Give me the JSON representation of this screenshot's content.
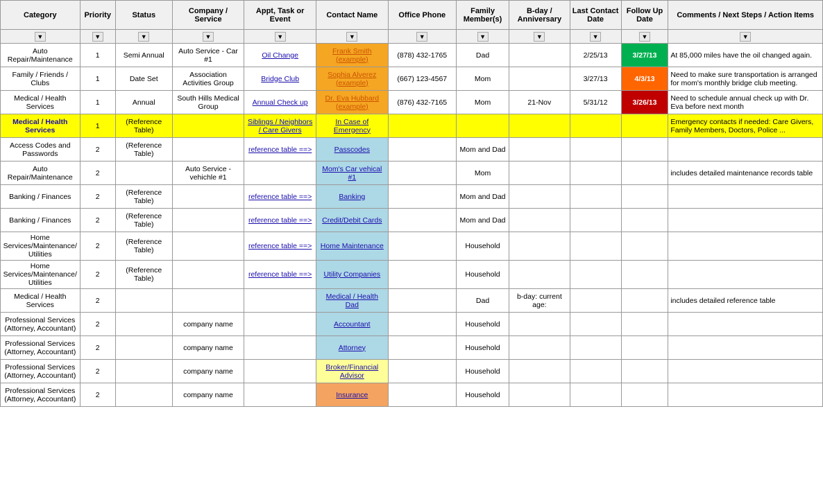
{
  "columns": [
    {
      "label": "Category",
      "class": "col-category"
    },
    {
      "label": "Priority",
      "class": "col-priority"
    },
    {
      "label": "Status",
      "class": "col-status"
    },
    {
      "label": "Company / Service",
      "class": "col-company"
    },
    {
      "label": "Appt, Task or Event",
      "class": "col-appt"
    },
    {
      "label": "Contact Name",
      "class": "col-contact"
    },
    {
      "label": "Office Phone",
      "class": "col-phone"
    },
    {
      "label": "Family Member(s)",
      "class": "col-family"
    },
    {
      "label": "B-day / Anniversary",
      "class": "col-bday"
    },
    {
      "label": "Last Contact Date",
      "class": "col-lastcontact"
    },
    {
      "label": "Follow Up Date",
      "class": "col-followup"
    },
    {
      "label": "Comments / Next Steps / Action Items",
      "class": "col-comments"
    }
  ],
  "rows": [
    {
      "category": "Auto\nRepair/Maintenance",
      "priority": "1",
      "status": "Semi Annual",
      "company": "Auto Service - Car #1",
      "appt": "Oil Change",
      "appt_link": true,
      "contact": "Frank Smith  (example)",
      "contact_style": "orange",
      "phone": "(878) 432-1765",
      "family": "Dad",
      "bday": "",
      "lastcontact": "2/25/13",
      "followup": "3/27/13",
      "followup_style": "green",
      "comments": "At 85,000 miles have the oil changed again.",
      "row_style": "white"
    },
    {
      "category": "Family / Friends / Clubs",
      "priority": "1",
      "status": "Date Set",
      "company": "Association Activities Group",
      "appt": "Bridge Club",
      "appt_link": true,
      "contact": "Sophia Alverez  (example)",
      "contact_style": "orange",
      "phone": "(667) 123-4567",
      "family": "Mom",
      "bday": "",
      "lastcontact": "3/27/13",
      "followup": "4/3/13",
      "followup_style": "orange",
      "comments": "Need to make sure transportation is arranged for mom's monthly bridge club meeting.",
      "row_style": "white"
    },
    {
      "category": "Medical / Health Services",
      "priority": "1",
      "status": "Annual",
      "company": "South Hills Medical Group",
      "appt": "Annual Check up",
      "appt_link": true,
      "contact": "Dr. Eva Hubbard  (example)",
      "contact_style": "orange",
      "phone": "(876) 432-7165",
      "family": "Mom",
      "bday": "21-Nov",
      "lastcontact": "5/31/12",
      "followup": "3/26/13",
      "followup_style": "red",
      "comments": "Need to schedule annual check up with Dr. Eva before next month",
      "row_style": "white"
    },
    {
      "category": "Medical / Health Services",
      "priority": "1",
      "status": "(Reference Table)",
      "company": "",
      "appt": "Siblings / Neighbors / Care Givers",
      "appt_link": true,
      "contact": "In Case of Emergency",
      "contact_style": "yellow",
      "phone": "",
      "family": "",
      "bday": "",
      "lastcontact": "",
      "followup": "",
      "followup_style": "",
      "comments": "Emergency contacts if needed: Care Givers, Family Members, Doctors, Police ...",
      "row_style": "yellow"
    },
    {
      "category": "Access Codes and Passwords",
      "priority": "2",
      "status": "(Reference Table)",
      "company": "",
      "appt": "reference table  ==>",
      "appt_link": true,
      "contact": "Passcodes",
      "contact_style": "lightblue",
      "phone": "",
      "family": "Mom and Dad",
      "bday": "",
      "lastcontact": "",
      "followup": "",
      "followup_style": "",
      "comments": "",
      "row_style": "white"
    },
    {
      "category": "Auto\nRepair/Maintenance",
      "priority": "2",
      "status": "",
      "company": "Auto Service - vehichle #1",
      "appt": "",
      "appt_link": false,
      "contact": "Mom's Car vehical #1",
      "contact_style": "lightblue",
      "phone": "",
      "family": "Mom",
      "bday": "",
      "lastcontact": "",
      "followup": "",
      "followup_style": "",
      "comments": "includes detailed maintenance records table",
      "row_style": "white"
    },
    {
      "category": "Banking / Finances",
      "priority": "2",
      "status": "(Reference Table)",
      "company": "",
      "appt": "reference table  ==>",
      "appt_link": true,
      "contact": "Banking",
      "contact_style": "lightblue",
      "phone": "",
      "family": "Mom and Dad",
      "bday": "",
      "lastcontact": "",
      "followup": "",
      "followup_style": "",
      "comments": "",
      "row_style": "white"
    },
    {
      "category": "Banking / Finances",
      "priority": "2",
      "status": "(Reference Table)",
      "company": "",
      "appt": "reference table  ==>",
      "appt_link": true,
      "contact": "Credit/Debit Cards",
      "contact_style": "lightblue",
      "phone": "",
      "family": "Mom and Dad",
      "bday": "",
      "lastcontact": "",
      "followup": "",
      "followup_style": "",
      "comments": "",
      "row_style": "white"
    },
    {
      "category": "Home Services/Maintenance/Utilities",
      "priority": "2",
      "status": "(Reference Table)",
      "company": "",
      "appt": "reference table  ==>",
      "appt_link": true,
      "contact": "Home Maintenance",
      "contact_style": "lightblue",
      "phone": "",
      "family": "Household",
      "bday": "",
      "lastcontact": "",
      "followup": "",
      "followup_style": "",
      "comments": "",
      "row_style": "white"
    },
    {
      "category": "Home Services/Maintenance/Utilities",
      "priority": "2",
      "status": "(Reference Table)",
      "company": "",
      "appt": "reference table  ==>",
      "appt_link": true,
      "contact": "Utility Companies",
      "contact_style": "lightblue",
      "phone": "",
      "family": "Household",
      "bday": "",
      "lastcontact": "",
      "followup": "",
      "followup_style": "",
      "comments": "",
      "row_style": "white"
    },
    {
      "category": "Medical / Health Services",
      "priority": "2",
      "status": "",
      "company": "",
      "appt": "",
      "appt_link": false,
      "contact": "Medical / Health Dad",
      "contact_style": "lightblue",
      "phone": "",
      "family": "Dad",
      "bday": "b-day: current age:",
      "lastcontact": "",
      "followup": "",
      "followup_style": "",
      "comments": "includes detailed reference table",
      "row_style": "white"
    },
    {
      "category": "Professional Services (Attorney, Accountant)",
      "priority": "2",
      "status": "",
      "company": "company name",
      "appt": "",
      "appt_link": false,
      "contact": "Accountant",
      "contact_style": "lightblue",
      "phone": "",
      "family": "Household",
      "bday": "",
      "lastcontact": "",
      "followup": "",
      "followup_style": "",
      "comments": "",
      "row_style": "white"
    },
    {
      "category": "Professional Services (Attorney, Accountant)",
      "priority": "2",
      "status": "",
      "company": "company name",
      "appt": "",
      "appt_link": false,
      "contact": "Attorney",
      "contact_style": "lightblue",
      "phone": "",
      "family": "Household",
      "bday": "",
      "lastcontact": "",
      "followup": "",
      "followup_style": "",
      "comments": "",
      "row_style": "white"
    },
    {
      "category": "Professional Services (Attorney, Accountant)",
      "priority": "2",
      "status": "",
      "company": "company name",
      "appt": "",
      "appt_link": false,
      "contact": "Broker/Financial Advisor",
      "contact_style": "lightyellow",
      "phone": "",
      "family": "Household",
      "bday": "",
      "lastcontact": "",
      "followup": "",
      "followup_style": "",
      "comments": "",
      "row_style": "white"
    },
    {
      "category": "Professional Services (Attorney, Accountant)",
      "priority": "2",
      "status": "",
      "company": "company name",
      "appt": "",
      "appt_link": false,
      "contact": "Insurance",
      "contact_style": "salmon",
      "phone": "",
      "family": "Household",
      "bday": "",
      "lastcontact": "",
      "followup": "",
      "followup_style": "",
      "comments": "",
      "row_style": "white"
    }
  ]
}
